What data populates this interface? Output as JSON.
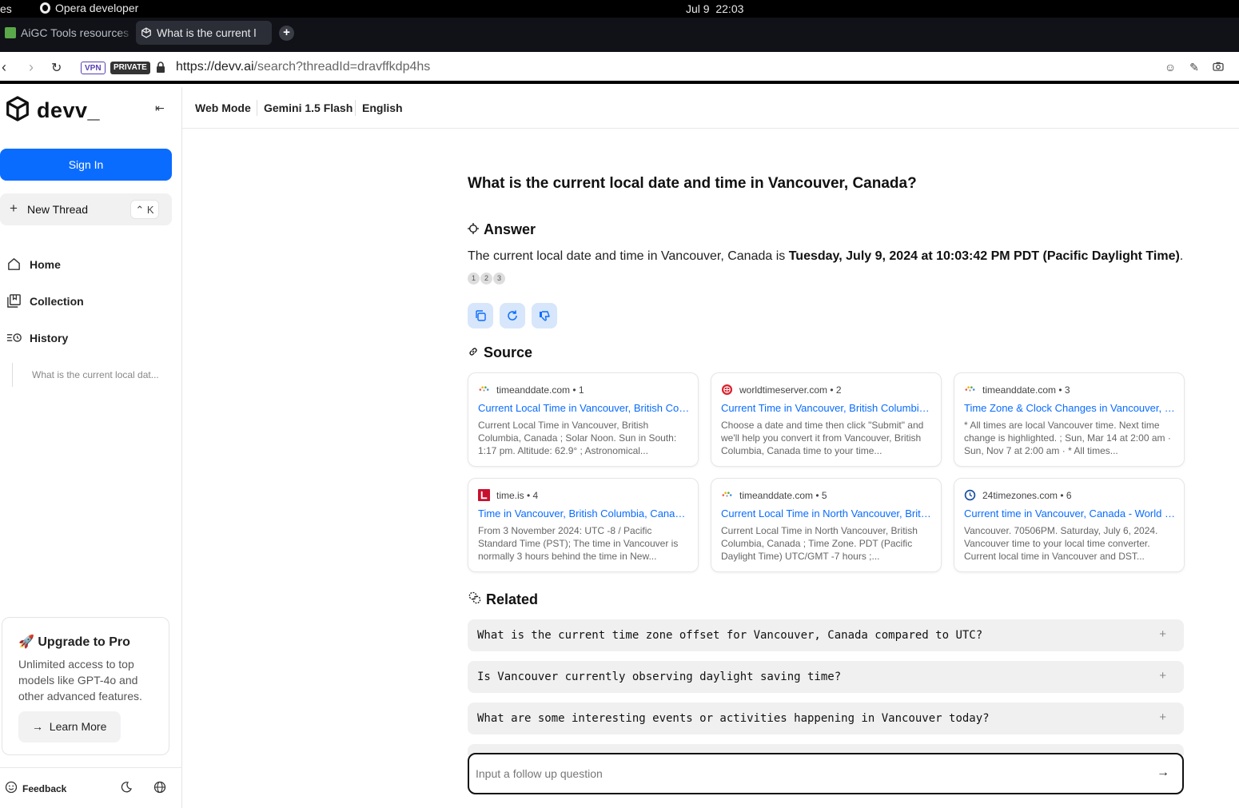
{
  "os_bar": {
    "left_text": "es",
    "app_name": "Opera developer",
    "date": "Jul 9",
    "time": "22:03"
  },
  "tabs": [
    {
      "title": "AiGC Tools resources",
      "active": false
    },
    {
      "title": "What is the current l",
      "active": true
    }
  ],
  "address_bar": {
    "vpn_label": "VPN",
    "private_label": "PRIVATE",
    "url_host": "https://devv.ai",
    "url_path": "/search?threadId=dravffkdp4hs"
  },
  "sidebar": {
    "brand": "devv_",
    "sign_in_label": "Sign In",
    "new_thread_label": "New Thread",
    "new_thread_shortcut": "⌃ K",
    "nav": [
      {
        "label": "Home",
        "icon": "home-icon"
      },
      {
        "label": "Collection",
        "icon": "collection-icon"
      },
      {
        "label": "History",
        "icon": "history-icon"
      }
    ],
    "history_items": [
      "What is the current local dat..."
    ],
    "upgrade": {
      "title": "🚀 Upgrade to Pro",
      "description": "Unlimited access to top models like GPT-4o and other advanced features.",
      "button_label": "Learn More"
    },
    "feedback_label": "Feedback"
  },
  "mode_bar": {
    "mode": "Web Mode",
    "model": "Gemini 1.5 Flash",
    "language": "English"
  },
  "main": {
    "question": "What is the current local date and time in Vancouver, Canada?",
    "answer_heading": "Answer",
    "answer_prefix": "The current local date and time in Vancouver, Canada is ",
    "answer_bold": "Tuesday, July 9, 2024 at 10:03:42 PM PDT (Pacific Daylight Time)",
    "answer_suffix": ".",
    "citations": [
      "1",
      "2",
      "3"
    ],
    "source_heading": "Source",
    "sources": [
      {
        "site": "timeanddate.com • 1",
        "favicon": "timeanddate-icon",
        "title": "Current Local Time in Vancouver, British Columbia, Canada",
        "snippet": "Current Local Time in Vancouver, British Columbia, Canada ; Solar Noon. Sun in South: 1:17 pm. Altitude: 62.9° ; Astronomical..."
      },
      {
        "site": "worldtimeserver.com • 2",
        "favicon": "worldtimeserver-icon",
        "title": "Current Time in Vancouver, British Columbia, Canada",
        "snippet": "Choose a date and time then click \"Submit\" and we'll help you convert it from Vancouver, British Columbia, Canada time to your time..."
      },
      {
        "site": "timeanddate.com • 3",
        "favicon": "timeanddate-icon",
        "title": "Time Zone & Clock Changes in Vancouver, British Columbia",
        "snippet": "* All times are local Vancouver time. Next time change is highlighted. ; Sun, Mar 14 at 2:00 am · Sun, Nov 7 at 2:00 am · * All times..."
      },
      {
        "site": "time.is • 4",
        "favicon": "timeis-icon",
        "title": "Time in Vancouver, British Columbia, Canada now",
        "snippet": "From 3 November 2024: UTC -8 / Pacific Standard Time (PST); The time in Vancouver is normally 3 hours behind the time in New..."
      },
      {
        "site": "timeanddate.com • 5",
        "favicon": "timeanddate-icon",
        "title": "Current Local Time in North Vancouver, British Columbia",
        "snippet": "Current Local Time in North Vancouver, British Columbia, Canada ; Time Zone. PDT (Pacific Daylight Time) UTC/GMT -7 hours ;..."
      },
      {
        "site": "24timezones.com • 6",
        "favicon": "24timezones-icon",
        "title": "Current time in Vancouver, Canada - World Clock",
        "snippet": "Vancouver. 70506PM. Saturday, July 6, 2024. Vancouver time to your local time converter. Current local time in Vancouver and DST..."
      }
    ],
    "related_heading": "Related",
    "related": [
      "What is the current time zone offset for Vancouver, Canada compared to UTC?",
      "Is Vancouver currently observing daylight saving time?",
      "What are some interesting events or activities happening in Vancouver today?"
    ],
    "followup_placeholder": "Input a follow up question"
  },
  "colors": {
    "accent": "#0a6cff",
    "action_bg": "#d7e6fb",
    "related_bg": "#f0f0f1"
  }
}
